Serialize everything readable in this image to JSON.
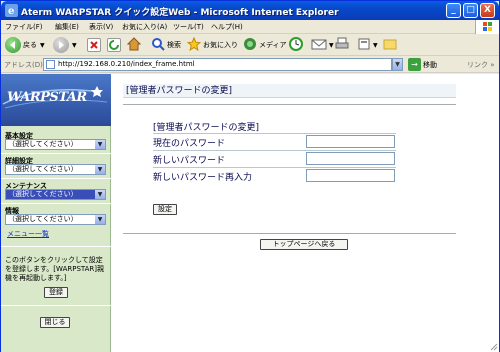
{
  "window": {
    "title": "Aterm WARPSTAR クイック設定Web - Microsoft Internet Explorer",
    "controls": {
      "minimize": "_",
      "maximize": "□",
      "close": "X"
    }
  },
  "menubar": {
    "items": [
      {
        "label": "ファイル(F)"
      },
      {
        "label": "編集(E)"
      },
      {
        "label": "表示(V)"
      },
      {
        "label": "お気に入り(A)"
      },
      {
        "label": "ツール(T)"
      },
      {
        "label": "ヘルプ(H)"
      }
    ]
  },
  "toolbar": {
    "back": "戻る",
    "search": "検索",
    "favorites": "お気に入り",
    "media": "メディア"
  },
  "addressbar": {
    "label": "アドレス(D)",
    "url": "http://192.168.0.210/index_frame.html",
    "go": "移動",
    "links": "リンク »"
  },
  "sidebar": {
    "logo": "WARPSTAR",
    "sections": [
      {
        "label": "基本設定",
        "select": "（選択してください）"
      },
      {
        "label": "詳細設定",
        "select": "（選択してください）"
      },
      {
        "label": "メンテナンス",
        "select": "（選択してください）"
      },
      {
        "label": "情報",
        "select": "（選択してください）"
      }
    ],
    "menu_link": "メニュー一覧",
    "note": "このボタンをクリックして設定を登録します。[WARPSTAR]親機を再起動します。]",
    "register_button": "登録",
    "close_button": "閉じる"
  },
  "main": {
    "title": "[管理者パスワードの変更]",
    "form_title": "[管理者パスワードの変更]",
    "fields": [
      {
        "label": "現在のパスワード",
        "value": ""
      },
      {
        "label": "新しいパスワード",
        "value": ""
      },
      {
        "label": "新しいパスワード再入力",
        "value": ""
      }
    ],
    "submit_button": "設定",
    "top_page_button": "トップページへ戻る"
  },
  "colors": {
    "titlebar": "#0A5CE8",
    "sidebar_bg": "#D8E8C8",
    "accent_text": "#0A0A50"
  }
}
